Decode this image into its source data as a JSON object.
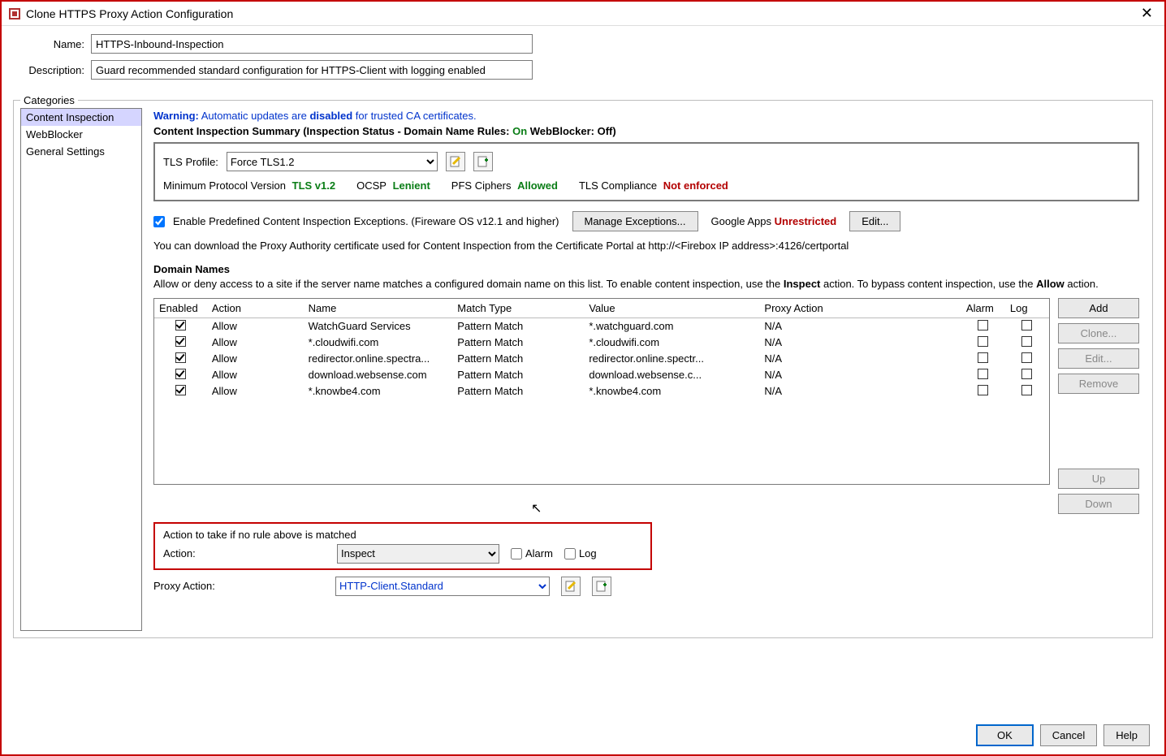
{
  "window": {
    "title": "Clone HTTPS Proxy Action Configuration"
  },
  "form": {
    "name_label": "Name:",
    "name_value": "HTTPS-Inbound-Inspection",
    "desc_label": "Description:",
    "desc_value": "Guard recommended standard configuration for HTTPS-Client with logging enabled"
  },
  "categories": {
    "legend": "Categories",
    "items": [
      "Content Inspection",
      "WebBlocker",
      "General Settings"
    ],
    "selected": "Content Inspection"
  },
  "warning": {
    "prefix": "Warning:",
    "rest": " Automatic updates are ",
    "bold": "disabled",
    "tail": " for trusted CA certificates."
  },
  "summary": {
    "head": "Content Inspection Summary   (Inspection Status  -  Domain Name Rules: ",
    "on": "On",
    "mid": "  WebBlocker: ",
    "off": "Off",
    "tail": ")"
  },
  "tls": {
    "profile_label": "TLS Profile:",
    "profile_value": "Force TLS1.2",
    "min_proto_label": "Minimum Protocol Version",
    "min_proto_value": "TLS v1.2",
    "ocsp_label": "OCSP",
    "ocsp_value": "Lenient",
    "pfs_label": "PFS Ciphers",
    "pfs_value": "Allowed",
    "compl_label": "TLS Compliance",
    "compl_value": "Not enforced"
  },
  "exceptions": {
    "checkbox_label": "Enable Predefined Content Inspection Exceptions. (Fireware OS v12.1 and higher)",
    "manage_btn": "Manage Exceptions...",
    "google_label": "Google Apps",
    "google_value": "Unrestricted",
    "edit_btn": "Edit..."
  },
  "cert_note": "You can download the Proxy Authority certificate used for Content Inspection from the Certificate Portal at http://<Firebox IP address>:4126/certportal",
  "domain_names": {
    "title": "Domain Names",
    "desc_pre": "Allow or deny access to a site if the server name matches a configured domain name on this list. To enable content inspection, use the ",
    "desc_inspect": "Inspect",
    "desc_mid": " action. To bypass content inspection, use the ",
    "desc_allow": "Allow",
    "desc_post": " action.",
    "headers": [
      "Enabled",
      "Action",
      "Name",
      "Match Type",
      "Value",
      "Proxy Action",
      "Alarm",
      "Log"
    ],
    "rows": [
      {
        "enabled": true,
        "action": "Allow",
        "name": "WatchGuard Services",
        "match": "Pattern Match",
        "value": "*.watchguard.com",
        "pa": "N/A",
        "alarm": false,
        "log": false
      },
      {
        "enabled": true,
        "action": "Allow",
        "name": "*.cloudwifi.com",
        "match": "Pattern Match",
        "value": "*.cloudwifi.com",
        "pa": "N/A",
        "alarm": false,
        "log": false
      },
      {
        "enabled": true,
        "action": "Allow",
        "name": "redirector.online.spectra...",
        "match": "Pattern Match",
        "value": "redirector.online.spectr...",
        "pa": "N/A",
        "alarm": false,
        "log": false
      },
      {
        "enabled": true,
        "action": "Allow",
        "name": "download.websense.com",
        "match": "Pattern Match",
        "value": "download.websense.c...",
        "pa": "N/A",
        "alarm": false,
        "log": false
      },
      {
        "enabled": true,
        "action": "Allow",
        "name": "*.knowbe4.com",
        "match": "Pattern Match",
        "value": "*.knowbe4.com",
        "pa": "N/A",
        "alarm": false,
        "log": false
      }
    ],
    "buttons": {
      "add": "Add",
      "clone": "Clone...",
      "edit": "Edit...",
      "remove": "Remove",
      "up": "Up",
      "down": "Down"
    }
  },
  "fallback": {
    "title": "Action to take if no rule above is matched",
    "action_label": "Action:",
    "action_value": "Inspect",
    "alarm_label": "Alarm",
    "log_label": "Log"
  },
  "proxy_action": {
    "label": "Proxy Action:",
    "value": "HTTP-Client.Standard"
  },
  "footer": {
    "ok": "OK",
    "cancel": "Cancel",
    "help": "Help"
  }
}
